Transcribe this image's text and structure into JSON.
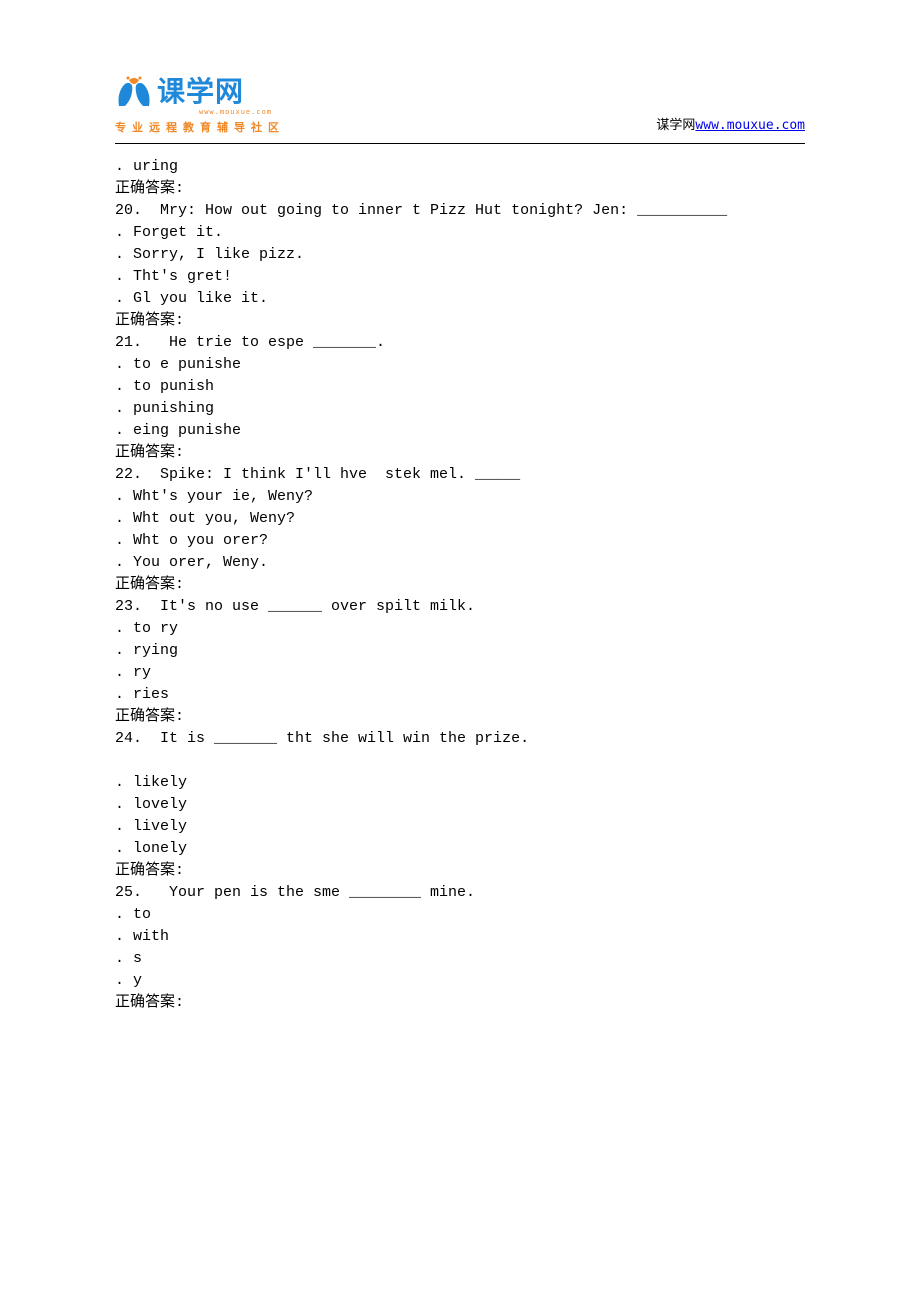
{
  "header": {
    "logo_text": "课学网",
    "logo_sub": "www.mouxue.com",
    "tagline": "专业远程教育辅导社区",
    "site_label": "谋学网",
    "site_url": "www.mouxue.com"
  },
  "lines": [
    ". uring",
    "正确答案:",
    "20.  Mry: How out going to inner t Pizz Hut tonight? Jen: __________",
    ". Forget it.",
    ". Sorry, I like pizz.",
    ". Tht's gret!",
    ". Gl you like it.",
    "正确答案:",
    "21.   He trie to espe _______.",
    ". to e punishe",
    ". to punish",
    ". punishing",
    ". eing punishe",
    "正确答案:",
    "22.  Spike: I think I'll hve  stek mel. _____",
    ". Wht's your ie, Weny?",
    ". Wht out you, Weny?",
    ". Wht o you orer?",
    ". You orer, Weny.",
    "正确答案:",
    "23.  It's no use ______ over spilt milk.",
    ". to ry",
    ". rying",
    ". ry",
    ". ries",
    "正确答案:",
    "24.  It is _______ tht she will win the prize.",
    "",
    ". likely",
    ". lovely",
    ". lively",
    ". lonely",
    "正确答案:",
    "25.   Your pen is the sme ________ mine.",
    ". to",
    ". with",
    ". s",
    ". y",
    "正确答案:"
  ]
}
